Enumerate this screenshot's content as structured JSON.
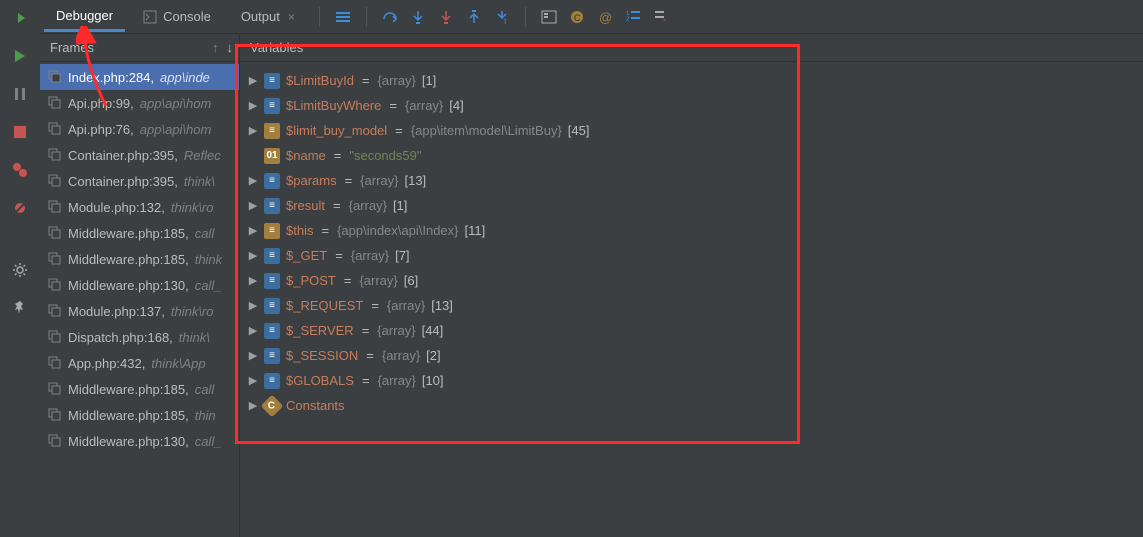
{
  "tabs": {
    "debugger": "Debugger",
    "console": "Console",
    "output": "Output"
  },
  "panels": {
    "frames_title": "Frames",
    "variables_title": "Variables"
  },
  "frames": [
    {
      "file": "Index.php:284",
      "loc": "app\\inde",
      "selected": true
    },
    {
      "file": "Api.php:99",
      "loc": "app\\api\\hom"
    },
    {
      "file": "Api.php:76",
      "loc": "app\\api\\hom"
    },
    {
      "file": "Container.php:395",
      "loc": "Reflec"
    },
    {
      "file": "Container.php:395",
      "loc": "think\\"
    },
    {
      "file": "Module.php:132",
      "loc": "think\\ro"
    },
    {
      "file": "Middleware.php:185",
      "loc": "call"
    },
    {
      "file": "Middleware.php:185",
      "loc": "think"
    },
    {
      "file": "Middleware.php:130",
      "loc": "call_"
    },
    {
      "file": "Module.php:137",
      "loc": "think\\ro"
    },
    {
      "file": "Dispatch.php:168",
      "loc": "think\\"
    },
    {
      "file": "App.php:432",
      "loc": "think\\App"
    },
    {
      "file": "Middleware.php:185",
      "loc": "call"
    },
    {
      "file": "Middleware.php:185",
      "loc": "thin"
    },
    {
      "file": "Middleware.php:130",
      "loc": "call_"
    }
  ],
  "variables": [
    {
      "name": "$LimitBuyId",
      "type": "{array}",
      "count": "[1]",
      "ico": "arr",
      "exp": true
    },
    {
      "name": "$LimitBuyWhere",
      "type": "{array}",
      "count": "[4]",
      "ico": "arr",
      "exp": true
    },
    {
      "name": "$limit_buy_model",
      "type": "{app\\item\\model\\LimitBuy}",
      "count": "[45]",
      "ico": "obj",
      "exp": true
    },
    {
      "name": "$name",
      "val": "\"seconds59\"",
      "ico": "str",
      "exp": false
    },
    {
      "name": "$params",
      "type": "{array}",
      "count": "[13]",
      "ico": "arr",
      "exp": true
    },
    {
      "name": "$result",
      "type": "{array}",
      "count": "[1]",
      "ico": "arr",
      "exp": true
    },
    {
      "name": "$this",
      "type": "{app\\index\\api\\Index}",
      "count": "[11]",
      "ico": "obj",
      "exp": true
    },
    {
      "name": "$_GET",
      "type": "{array}",
      "count": "[7]",
      "ico": "arr",
      "exp": true
    },
    {
      "name": "$_POST",
      "type": "{array}",
      "count": "[6]",
      "ico": "arr",
      "exp": true
    },
    {
      "name": "$_REQUEST",
      "type": "{array}",
      "count": "[13]",
      "ico": "arr",
      "exp": true
    },
    {
      "name": "$_SERVER",
      "type": "{array}",
      "count": "[44]",
      "ico": "arr",
      "exp": true
    },
    {
      "name": "$_SESSION",
      "type": "{array}",
      "count": "[2]",
      "ico": "arr",
      "exp": true
    },
    {
      "name": "$GLOBALS",
      "type": "{array}",
      "count": "[10]",
      "ico": "arr",
      "exp": true
    },
    {
      "name": "Constants",
      "ico": "const",
      "exp": true
    }
  ],
  "icons": {
    "rerun": "rerun",
    "resume": "resume",
    "pause": "pause",
    "stop": "stop",
    "breakpoints": "breakpoints",
    "mute": "mute",
    "settings": "settings",
    "pin": "pin",
    "console": "console",
    "layout": "layout",
    "step_over": "step_over",
    "step_into": "step_into",
    "force_step_into": "force_step_into",
    "step_out": "step_out",
    "run_to_cursor": "run_to_cursor",
    "evaluate": "evaluate",
    "watches_c": "watches_c",
    "watches_at": "watches_at",
    "watches_list": "watches_list",
    "watches_rm": "watches_rm",
    "arrow_up": "up",
    "arrow_down": "down"
  }
}
